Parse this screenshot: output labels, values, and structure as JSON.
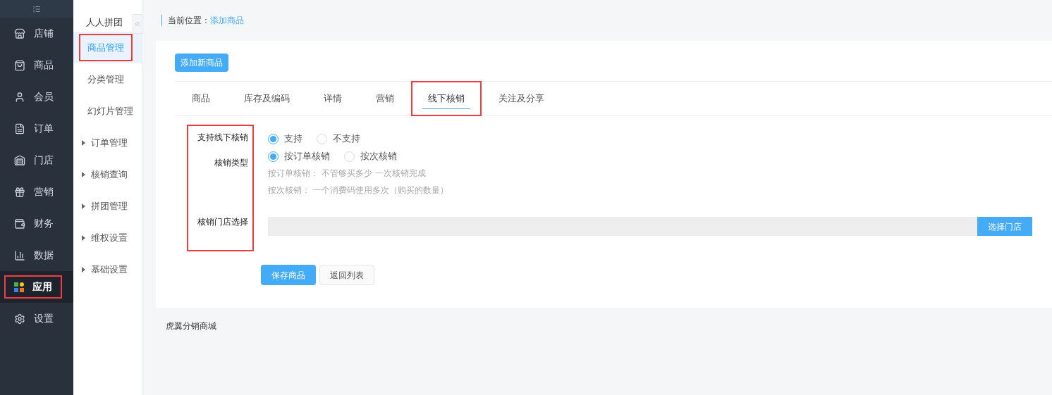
{
  "main_nav": {
    "items": [
      {
        "label": "店铺",
        "selected": false,
        "highlighted": false
      },
      {
        "label": "商品",
        "selected": false,
        "highlighted": false
      },
      {
        "label": "会员",
        "selected": false,
        "highlighted": false
      },
      {
        "label": "订单",
        "selected": false,
        "highlighted": false
      },
      {
        "label": "门店",
        "selected": false,
        "highlighted": false
      },
      {
        "label": "营销",
        "selected": false,
        "highlighted": false
      },
      {
        "label": "财务",
        "selected": false,
        "highlighted": false
      },
      {
        "label": "数据",
        "selected": false,
        "highlighted": false
      },
      {
        "label": "应用",
        "selected": true,
        "highlighted": true
      },
      {
        "label": "设置",
        "selected": false,
        "highlighted": false
      }
    ]
  },
  "sub_nav": {
    "title": "人人拼团",
    "items": [
      {
        "label": "商品管理",
        "kind": "link",
        "selected": true,
        "highlighted": true
      },
      {
        "label": "分类管理",
        "kind": "link",
        "selected": false,
        "highlighted": false
      },
      {
        "label": "幻灯片管理",
        "kind": "link",
        "selected": false,
        "highlighted": false
      },
      {
        "label": "订单管理",
        "kind": "group",
        "selected": false,
        "highlighted": false
      },
      {
        "label": "核销查询",
        "kind": "group",
        "selected": false,
        "highlighted": false
      },
      {
        "label": "拼团管理",
        "kind": "group",
        "selected": false,
        "highlighted": false
      },
      {
        "label": "维权设置",
        "kind": "group",
        "selected": false,
        "highlighted": false
      },
      {
        "label": "基础设置",
        "kind": "group",
        "selected": false,
        "highlighted": false
      }
    ]
  },
  "breadcrumb": {
    "label": "当前位置：",
    "current": "添加商品"
  },
  "add_button": "添加新商品",
  "tabs": [
    {
      "label": "商品",
      "selected": false,
      "highlighted": false
    },
    {
      "label": "库存及编码",
      "selected": false,
      "highlighted": false
    },
    {
      "label": "详情",
      "selected": false,
      "highlighted": false
    },
    {
      "label": "营销",
      "selected": false,
      "highlighted": false
    },
    {
      "label": "线下核销",
      "selected": true,
      "highlighted": true
    },
    {
      "label": "关注及分享",
      "selected": false,
      "highlighted": false
    }
  ],
  "form": {
    "labels_highlighted": true,
    "support": {
      "label": "支持线下核销",
      "options": [
        {
          "label": "支持",
          "selected": true
        },
        {
          "label": "不支持",
          "selected": false
        }
      ]
    },
    "type": {
      "label": "核销类型",
      "options": [
        {
          "label": "按订单核销",
          "selected": true
        },
        {
          "label": "按次核销",
          "selected": false
        }
      ],
      "hints": [
        "按订单核销： 不管够买多少 一次核销完成",
        "按次核销： 一个消费码使用多次（购买的数量）"
      ]
    },
    "store": {
      "label": "核销门店选择",
      "button": "选择门店"
    }
  },
  "actions": {
    "save": "保存商品",
    "back": "返回列表"
  },
  "footer": "虎翼分销商城"
}
